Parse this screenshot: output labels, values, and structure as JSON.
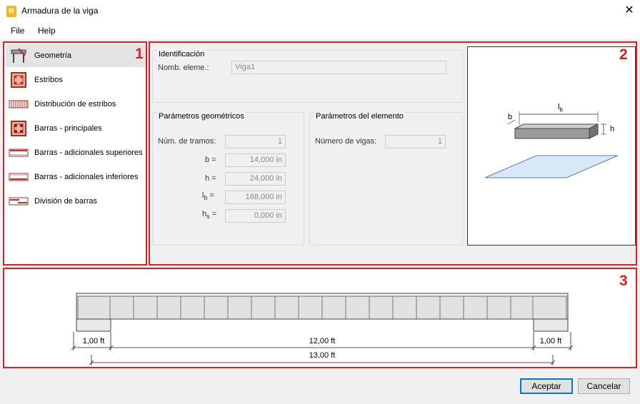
{
  "window": {
    "title": "Armadura de la viga",
    "app_icon": "R",
    "close_glyph": "✕"
  },
  "menu": {
    "file": "File",
    "help": "Help"
  },
  "nav": {
    "items": [
      {
        "label": "Geometría",
        "active": true
      },
      {
        "label": "Estribos"
      },
      {
        "label": "Distribución de estribos"
      },
      {
        "label": "Barras - principales"
      },
      {
        "label": "Barras - adicionales superiores"
      },
      {
        "label": "Barras - adicionales inferiores"
      },
      {
        "label": "División de barras"
      }
    ]
  },
  "markers": {
    "m1": "1",
    "m2": "2",
    "m3": "3"
  },
  "identificacion": {
    "title": "Identificación",
    "nomb_label": "Nomb. eleme.:",
    "nomb_value": "Viga1"
  },
  "geom": {
    "title": "Parámetros geométricos",
    "tramos_label": "Núm. de tramos:",
    "tramos_value": "1",
    "b_label": "b =",
    "b_value": "14,000 in",
    "h_label": "h =",
    "h_value": "24,000 in",
    "lb_l": "l",
    "lb_sub": "b",
    "lb_eq": "=",
    "lb_value": "168,000 in",
    "hs_l": "h",
    "hs_sub": "s",
    "hs_eq": "=",
    "hs_value": "0,000 in"
  },
  "elem": {
    "title": "Parámetros del elemento",
    "vigas_label": "Número de vigas:",
    "vigas_value": "1"
  },
  "preview": {
    "l": "l",
    "b_sub": "b",
    "b": "b",
    "h": "h"
  },
  "beam": {
    "left_support": "1,00 ft",
    "span": "12,00 ft",
    "right_support": "1,00 ft",
    "total": "13,00 ft"
  },
  "buttons": {
    "accept": "Aceptar",
    "cancel": "Cancelar"
  },
  "colors": {
    "accent_red": "#e02020",
    "primary_blue": "#0078d7"
  }
}
